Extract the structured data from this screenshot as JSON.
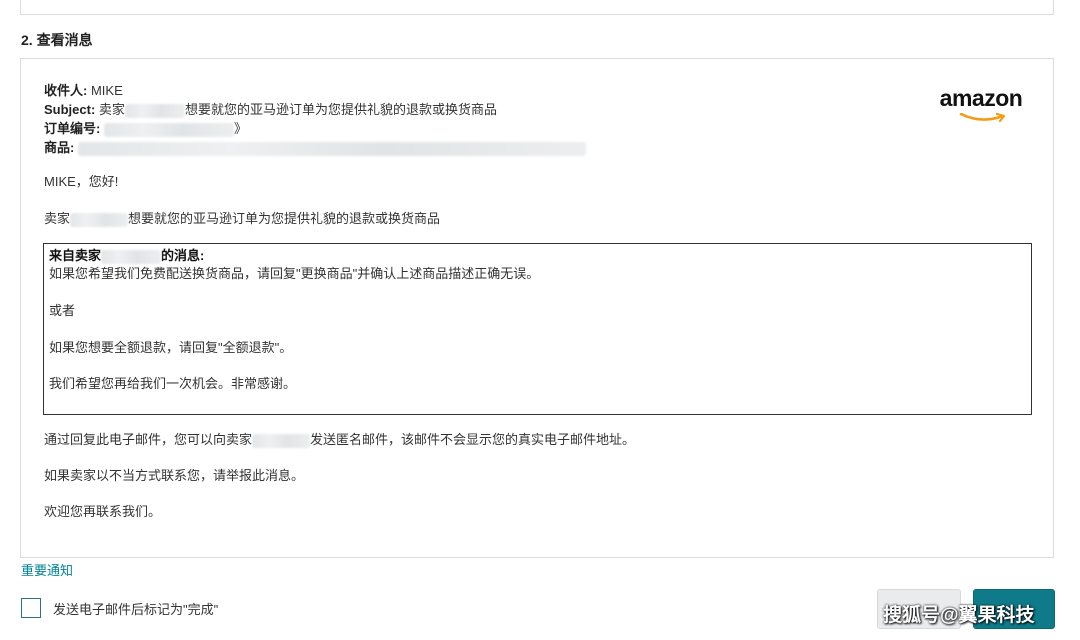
{
  "section": {
    "title": "2. 查看消息"
  },
  "email": {
    "logo_text": "amazon",
    "recipient_label": "收件人:",
    "recipient_value": "MIKE",
    "subject_label": "Subject:",
    "subject_prefix": "卖家",
    "subject_suffix": "想要就您的亚马逊订单为您提供礼貌的退款或换货商品",
    "order_label": "订单编号:",
    "order_suffix": "》",
    "product_label": "商品:",
    "greeting": "MIKE，您好!",
    "intro_prefix": "卖家",
    "intro_suffix": "想要就您的亚马逊订单为您提供礼貌的退款或换货商品",
    "message_box": {
      "header_prefix": "来自卖家",
      "header_suffix": "的消息:",
      "line1": "如果您希望我们免费配送换货商品，请回复\"更换商品\"并确认上述商品描述正确无误。",
      "line2": "或者",
      "line3": "如果您想要全额退款，请回复\"全额退款\"。",
      "line4": "我们希望您再给我们一次机会。非常感谢。"
    },
    "anon_prefix": "通过回复此电子邮件，您可以向卖家",
    "anon_suffix": "发送匿名邮件，该邮件不会显示您的真实电子邮件地址。",
    "report_text": "如果卖家以不当方式联系您，请举报此消息。",
    "welcome_text": "欢迎您再联系我们。"
  },
  "footer": {
    "notice_link": "重要通知",
    "checkbox_label": "发送电子邮件后标记为\"完成\"",
    "watermark": "搜狐号@翼果科技"
  },
  "colors": {
    "link": "#008296",
    "primary_button": "#0f7b8a",
    "border": "#dcdcdc"
  }
}
